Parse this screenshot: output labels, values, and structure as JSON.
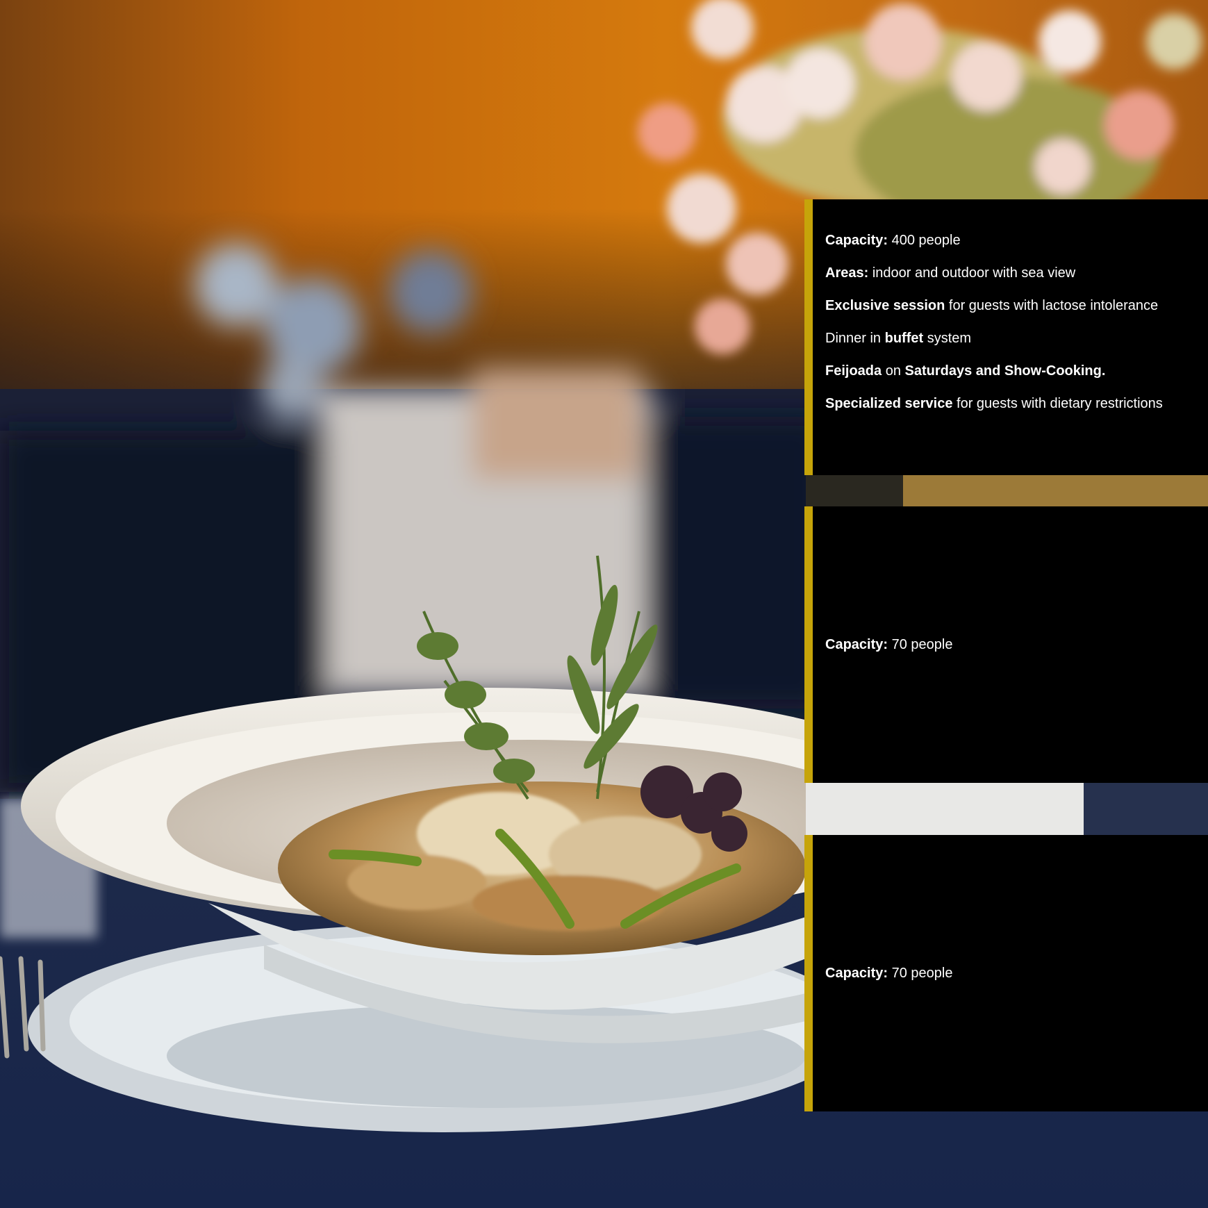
{
  "colors": {
    "accent": "#c6a40a",
    "panel_bg": "#000000",
    "text": "#ffffff"
  },
  "background": {
    "subject": "plated risotto with herbs on white bowl, flowers in background"
  },
  "panels": [
    {
      "items": [
        {
          "b1": "Capacity:",
          "t1": " 400 people"
        },
        {
          "b1": "Areas:",
          "t1": " indoor and outdoor with sea view"
        },
        {
          "b1": "Exclusive session",
          "t1": " for guests with lactose intolerance"
        },
        {
          "t0": "Dinner in ",
          "b1": "buffet",
          "t1": " system"
        },
        {
          "b1": "Feijoada",
          "t1": " on ",
          "b2": "Saturdays and Show-Cooking."
        },
        {
          "b1": "Specialized service",
          "t1": " for guests with dietary restrictions"
        }
      ]
    },
    {
      "items": [
        {
          "b1": "Capacity:",
          "t1": " 70 people"
        }
      ]
    },
    {
      "items": [
        {
          "b1": "Capacity:",
          "t1": " 70 people"
        }
      ]
    }
  ]
}
